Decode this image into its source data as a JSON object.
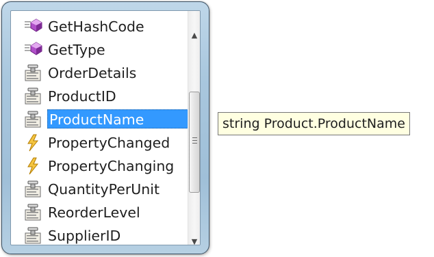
{
  "completion_list": {
    "items": [
      {
        "label": "GetHashCode",
        "icon": "method-icon",
        "selected": false
      },
      {
        "label": "GetType",
        "icon": "method-icon",
        "selected": false
      },
      {
        "label": "OrderDetails",
        "icon": "property-icon",
        "selected": false
      },
      {
        "label": "ProductID",
        "icon": "property-icon",
        "selected": false
      },
      {
        "label": "ProductName",
        "icon": "property-icon",
        "selected": true
      },
      {
        "label": "PropertyChanged",
        "icon": "event-icon",
        "selected": false
      },
      {
        "label": "PropertyChanging",
        "icon": "event-icon",
        "selected": false
      },
      {
        "label": "QuantityPerUnit",
        "icon": "property-icon",
        "selected": false
      },
      {
        "label": "ReorderLevel",
        "icon": "property-icon",
        "selected": false
      },
      {
        "label": "SupplierID",
        "icon": "property-icon",
        "selected": false
      }
    ],
    "scroll_up_glyph": "▲",
    "scroll_down_glyph": "▼"
  },
  "tooltip": {
    "text": "string Product.ProductName"
  },
  "colors": {
    "selection": "#3399ff",
    "tooltip_bg": "#ffffe1",
    "frame": "#a9c7de"
  }
}
